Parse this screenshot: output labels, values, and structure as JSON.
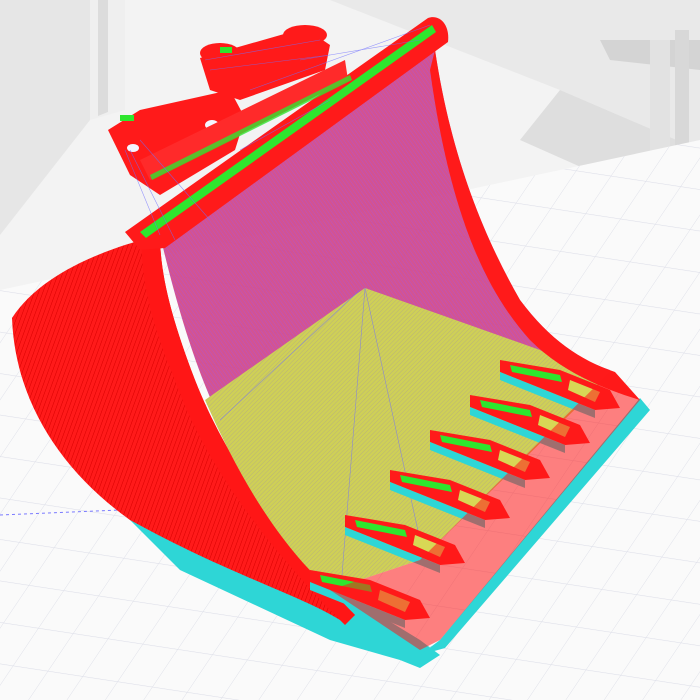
{
  "viewport": {
    "view": "slicer-preview-3d",
    "object": "excavator-bucket",
    "background_color": "#f3f3f3",
    "bed_color": "#fafafa",
    "grid_color": "#d9dbe6",
    "colors": {
      "outer_perimeter": "#ff1a1a",
      "inner_perimeter": "#ff2a00",
      "infill": "#d8d855",
      "skirt_brim": "#2ed6d6",
      "travel": "#6f6fff",
      "support_interface": "#2ee62e"
    },
    "teeth_count": 6
  }
}
